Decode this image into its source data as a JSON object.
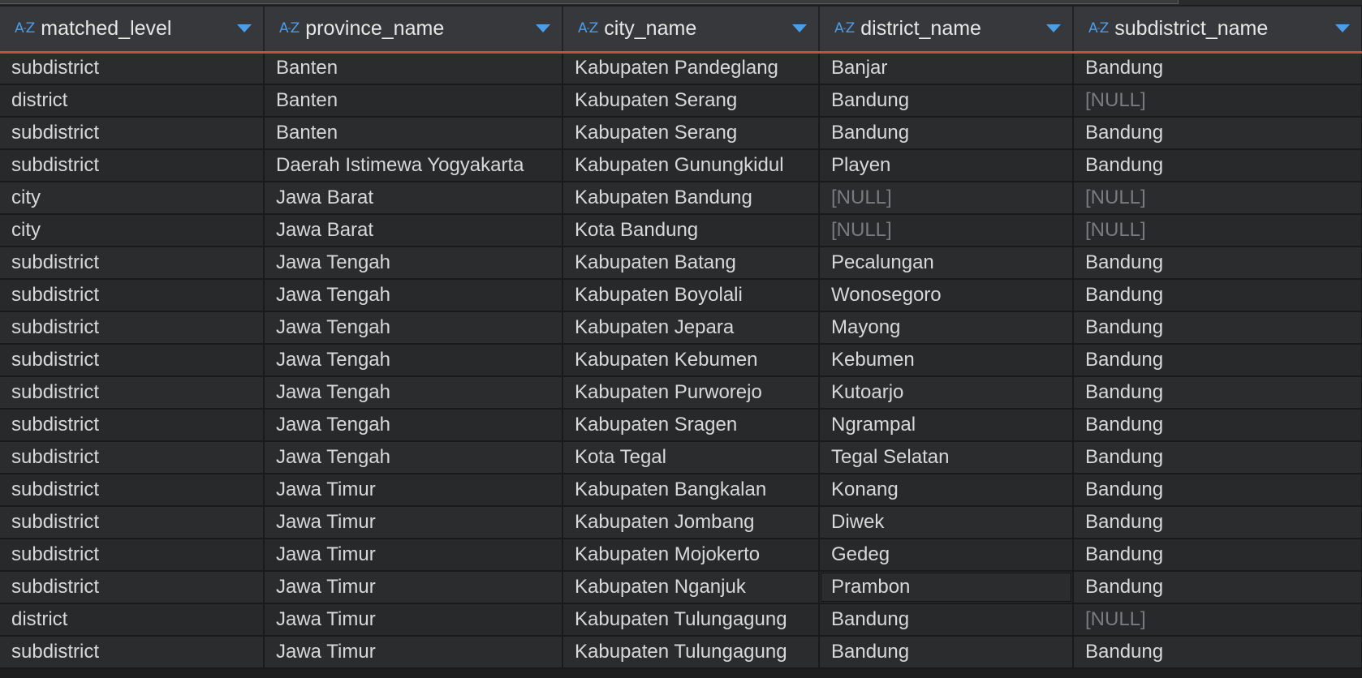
{
  "columns": [
    {
      "key": "matched_level",
      "label": "matched_level",
      "type_icon": "A-Z"
    },
    {
      "key": "province_name",
      "label": "province_name",
      "type_icon": "A-Z"
    },
    {
      "key": "city_name",
      "label": "city_name",
      "type_icon": "A-Z"
    },
    {
      "key": "district_name",
      "label": "district_name",
      "type_icon": "A-Z"
    },
    {
      "key": "subdistrict_name",
      "label": "subdistrict_name",
      "type_icon": "A-Z"
    }
  ],
  "null_text": "[NULL]",
  "rows": [
    [
      "subdistrict",
      "Banten",
      "Kabupaten Pandeglang",
      "Banjar",
      "Bandung"
    ],
    [
      "district",
      "Banten",
      "Kabupaten Serang",
      "Bandung",
      null
    ],
    [
      "subdistrict",
      "Banten",
      "Kabupaten Serang",
      "Bandung",
      "Bandung"
    ],
    [
      "subdistrict",
      "Daerah Istimewa Yogyakarta",
      "Kabupaten Gunungkidul",
      "Playen",
      "Bandung"
    ],
    [
      "city",
      "Jawa Barat",
      "Kabupaten Bandung",
      null,
      null
    ],
    [
      "city",
      "Jawa Barat",
      "Kota Bandung",
      null,
      null
    ],
    [
      "subdistrict",
      "Jawa Tengah",
      "Kabupaten Batang",
      "Pecalungan",
      "Bandung"
    ],
    [
      "subdistrict",
      "Jawa Tengah",
      "Kabupaten Boyolali",
      "Wonosegoro",
      "Bandung"
    ],
    [
      "subdistrict",
      "Jawa Tengah",
      "Kabupaten Jepara",
      "Mayong",
      "Bandung"
    ],
    [
      "subdistrict",
      "Jawa Tengah",
      "Kabupaten Kebumen",
      "Kebumen",
      "Bandung"
    ],
    [
      "subdistrict",
      "Jawa Tengah",
      "Kabupaten Purworejo",
      "Kutoarjo",
      "Bandung"
    ],
    [
      "subdistrict",
      "Jawa Tengah",
      "Kabupaten Sragen",
      "Ngrampal",
      "Bandung"
    ],
    [
      "subdistrict",
      "Jawa Tengah",
      "Kota Tegal",
      "Tegal Selatan",
      "Bandung"
    ],
    [
      "subdistrict",
      "Jawa Timur",
      "Kabupaten Bangkalan",
      "Konang",
      "Bandung"
    ],
    [
      "subdistrict",
      "Jawa Timur",
      "Kabupaten Jombang",
      "Diwek",
      "Bandung"
    ],
    [
      "subdistrict",
      "Jawa Timur",
      "Kabupaten Mojokerto",
      "Gedeg",
      "Bandung"
    ],
    [
      "subdistrict",
      "Jawa Timur",
      "Kabupaten Nganjuk",
      "Prambon",
      "Bandung"
    ],
    [
      "district",
      "Jawa Timur",
      "Kabupaten Tulungagung",
      "Bandung",
      null
    ],
    [
      "subdistrict",
      "Jawa Timur",
      "Kabupaten Tulungagung",
      "Bandung",
      "Bandung"
    ]
  ],
  "focused_cell": {
    "row": 16,
    "col": 3
  },
  "colors": {
    "header_bg": "#37383b",
    "header_underline": "#c4503d",
    "accent_icon": "#4a9ee8",
    "cell_text": "#d8d8d8",
    "null_text": "#7a7b7e"
  },
  "icons": {
    "type_icon": "text-type-icon",
    "sort": "sort-dropdown-icon"
  }
}
